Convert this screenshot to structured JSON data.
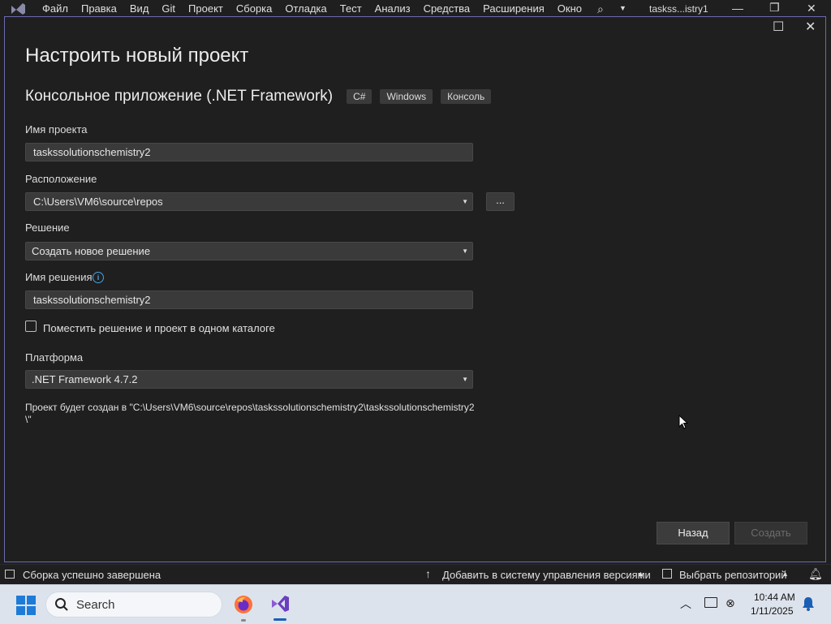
{
  "menubar": {
    "items": [
      "Файл",
      "Правка",
      "Вид",
      "Git",
      "Проект",
      "Сборка",
      "Отладка",
      "Тест",
      "Анализ",
      "Средства",
      "Расширения",
      "Окно"
    ],
    "window_title": "taskss...istry1"
  },
  "dialog": {
    "title": "Настроить новый проект",
    "template_name": "Консольное приложение (.NET Framework)",
    "tags": [
      "C#",
      "Windows",
      "Консоль"
    ],
    "project_name_label": "Имя проекта",
    "project_name_value": "taskssolutionschemistry2",
    "location_label": "Расположение",
    "location_value": "C:\\Users\\VM6\\source\\repos",
    "browse_label": "...",
    "solution_label": "Решение",
    "solution_value": "Создать новое решение",
    "solution_name_label": "Имя решения",
    "solution_name_value": "taskssolutionschemistry2",
    "same_dir_label": "Поместить решение и проект в одном каталоге",
    "same_dir_checked": false,
    "platform_label": "Платформа",
    "platform_value": ".NET Framework 4.7.2",
    "path_note": "Проект будет создан в \"C:\\Users\\VM6\\source\\repos\\taskssolutionschemistry2\\taskssolutionschemistry2\\\"",
    "back_label": "Назад",
    "create_label": "Создать"
  },
  "statusbar": {
    "status_text": "Сборка успешно завершена",
    "vcs_text": "Добавить в систему управления версиями",
    "repo_text": "Выбрать репозиторий"
  },
  "taskbar": {
    "search_label": "Search",
    "time": "10:44 AM",
    "date": "1/11/2025"
  },
  "icons": {
    "accent": "#6b6bb0",
    "info_color": "#4aa3df",
    "taskbar_active": "#1a5fb4"
  }
}
